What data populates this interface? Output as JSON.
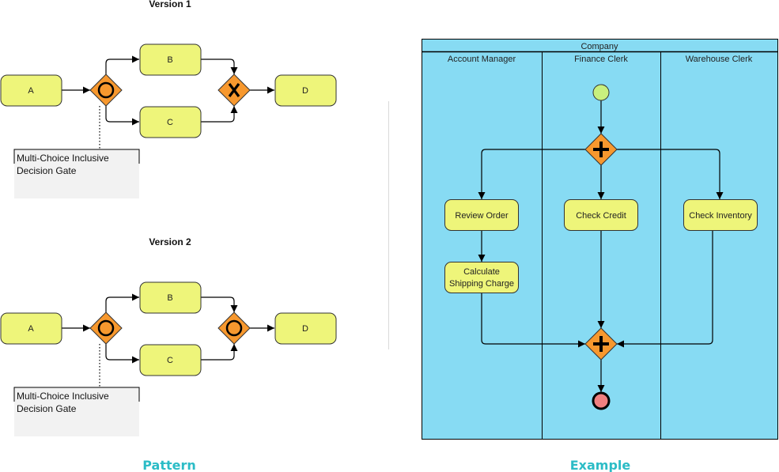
{
  "colors": {
    "task_fill": "#eef57a",
    "gateway_fill": "#f7982e",
    "pool_fill": "#87dbf3",
    "start_fill": "#c8f07e",
    "end_fill": "#f08080",
    "annotation_fill": "#f2f2f2",
    "caption": "#2bbcc6",
    "divider": "#d9d9d9"
  },
  "pattern": {
    "caption": "Pattern",
    "version1": {
      "title": "Version 1",
      "tasks": [
        "A",
        "B",
        "C",
        "D"
      ],
      "split_gateway": "inclusive",
      "join_gateway": "exclusive",
      "annotation_lines": [
        "Multi-Choice Inclusive",
        "Decision Gate"
      ]
    },
    "version2": {
      "title": "Version 2",
      "tasks": [
        "A",
        "B",
        "C",
        "D"
      ],
      "split_gateway": "inclusive",
      "join_gateway": "inclusive",
      "annotation_lines": [
        "Multi-Choice Inclusive",
        "Decision Gate"
      ]
    }
  },
  "example": {
    "caption": "Example",
    "pool": "Company",
    "lanes": [
      "Account Manager",
      "Finance Clerk",
      "Warehouse Clerk"
    ],
    "tasks": {
      "review_order": "Review Order",
      "check_credit": "Check Credit",
      "check_inventory": "Check Inventory",
      "calc_shipping": [
        "Calculate",
        "Shipping Charge"
      ]
    },
    "split_gateway": "parallel",
    "join_gateway": "parallel",
    "events": [
      "start",
      "end"
    ]
  }
}
